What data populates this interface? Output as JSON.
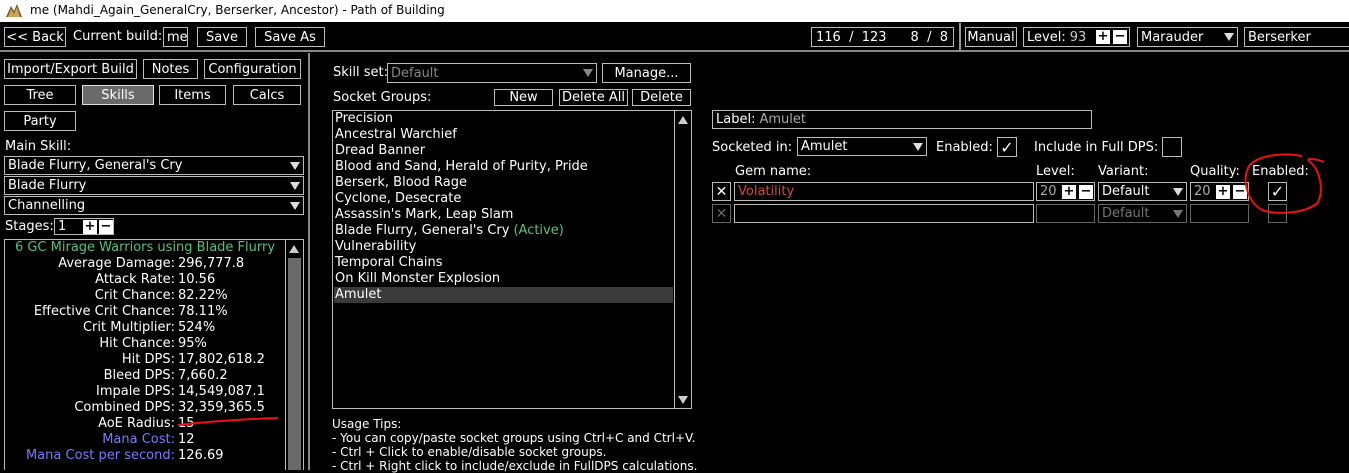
{
  "window": {
    "title": "me (Mahdi_Again_GeneralCry, Berserker, Ancestor) - Path of Building"
  },
  "topbar": {
    "back_label": "<< Back",
    "current_build_label": "Current build:",
    "build_name": "me",
    "save_label": "Save",
    "save_as_label": "Save As",
    "points": "116  /  123",
    "ascendancy_points": "8  /  8",
    "manual_label": "Manual",
    "level_label": "Level:",
    "level_value": "93",
    "class_value": "Marauder",
    "ascendancy_value": "Berserker"
  },
  "nav": {
    "import_export": "Import/Export Build",
    "notes": "Notes",
    "configuration": "Configuration",
    "tree": "Tree",
    "skills": "Skills",
    "items": "Items",
    "calcs": "Calcs",
    "party": "Party"
  },
  "sidebar": {
    "main_skill_label": "Main Skill:",
    "main_skill": "Blade Flurry, General's Cry",
    "active_skill": "Blade Flurry",
    "skill_part": "Channelling",
    "stages_label": "Stages:",
    "stages_value": "1",
    "stats_header": "6 GC Mirage Warriors using Blade Flurry",
    "stats": [
      {
        "label": "Average Damage:",
        "value": "296,777.8"
      },
      {
        "label": "Attack Rate:",
        "value": "10.56"
      },
      {
        "label": "Crit Chance:",
        "value": "82.22%"
      },
      {
        "label": "Effective Crit Chance:",
        "value": "78.11%"
      },
      {
        "label": "Crit Multiplier:",
        "value": "524%"
      },
      {
        "label": "Hit Chance:",
        "value": "95%"
      },
      {
        "label": "Hit DPS:",
        "value": "17,802,618.2"
      },
      {
        "label": "Bleed DPS:",
        "value": "7,660.2"
      },
      {
        "label": "Impale DPS:",
        "value": "14,549,087.1"
      },
      {
        "label": "Combined DPS:",
        "value": "32,359,365.5"
      },
      {
        "label": "AoE Radius:",
        "value": "15"
      },
      {
        "label": "Mana Cost:",
        "value": "12"
      },
      {
        "label": "Mana Cost per second:",
        "value": "126.69"
      }
    ],
    "colors": {
      "header": "#52c27a",
      "mana": "#7b7bff"
    }
  },
  "skills": {
    "skill_set_label": "Skill set:",
    "skill_set_value": "Default",
    "manage_label": "Manage...",
    "socket_groups_label": "Socket Groups:",
    "new_label": "New",
    "delete_all_label": "Delete All",
    "delete_label": "Delete",
    "groups": [
      {
        "name": "Precision",
        "suffix": ""
      },
      {
        "name": "Ancestral Warchief",
        "suffix": ""
      },
      {
        "name": "Dread Banner",
        "suffix": ""
      },
      {
        "name": "Blood and Sand, Herald of Purity, Pride",
        "suffix": ""
      },
      {
        "name": "Berserk, Blood Rage",
        "suffix": ""
      },
      {
        "name": "Cyclone, Desecrate",
        "suffix": ""
      },
      {
        "name": "Assassin's Mark, Leap Slam",
        "suffix": ""
      },
      {
        "name": "Blade Flurry, General's Cry",
        "suffix": "(Active)"
      },
      {
        "name": "Vulnerability",
        "suffix": ""
      },
      {
        "name": "Temporal Chains",
        "suffix": ""
      },
      {
        "name": "On Kill Monster Explosion",
        "suffix": ""
      },
      {
        "name": "Amulet",
        "suffix": ""
      }
    ],
    "usage_tips_title": "Usage Tips:",
    "tips": [
      "- You can copy/paste socket groups using Ctrl+C and Ctrl+V.",
      "- Ctrl + Click to enable/disable socket groups.",
      "- Ctrl + Right click to include/exclude in FullDPS calculations."
    ]
  },
  "group_detail": {
    "label_label": "Label:",
    "label_value": "Amulet",
    "socketed_in_label": "Socketed in:",
    "socketed_in_value": "Amulet",
    "enabled_label": "Enabled:",
    "include_full_dps_label": "Include in Full DPS:",
    "gem_name_header": "Gem name:",
    "level_header": "Level:",
    "variant_header": "Variant:",
    "quality_header": "Quality:",
    "enabled_header": "Enabled:",
    "gems": [
      {
        "name": "Volatility",
        "level": "20",
        "variant": "Default",
        "quality": "20",
        "enabled": "✓"
      },
      {
        "name": "",
        "level": "",
        "variant": "Default",
        "quality": "",
        "enabled": ""
      }
    ],
    "gem_name_color": "#d9453a"
  }
}
